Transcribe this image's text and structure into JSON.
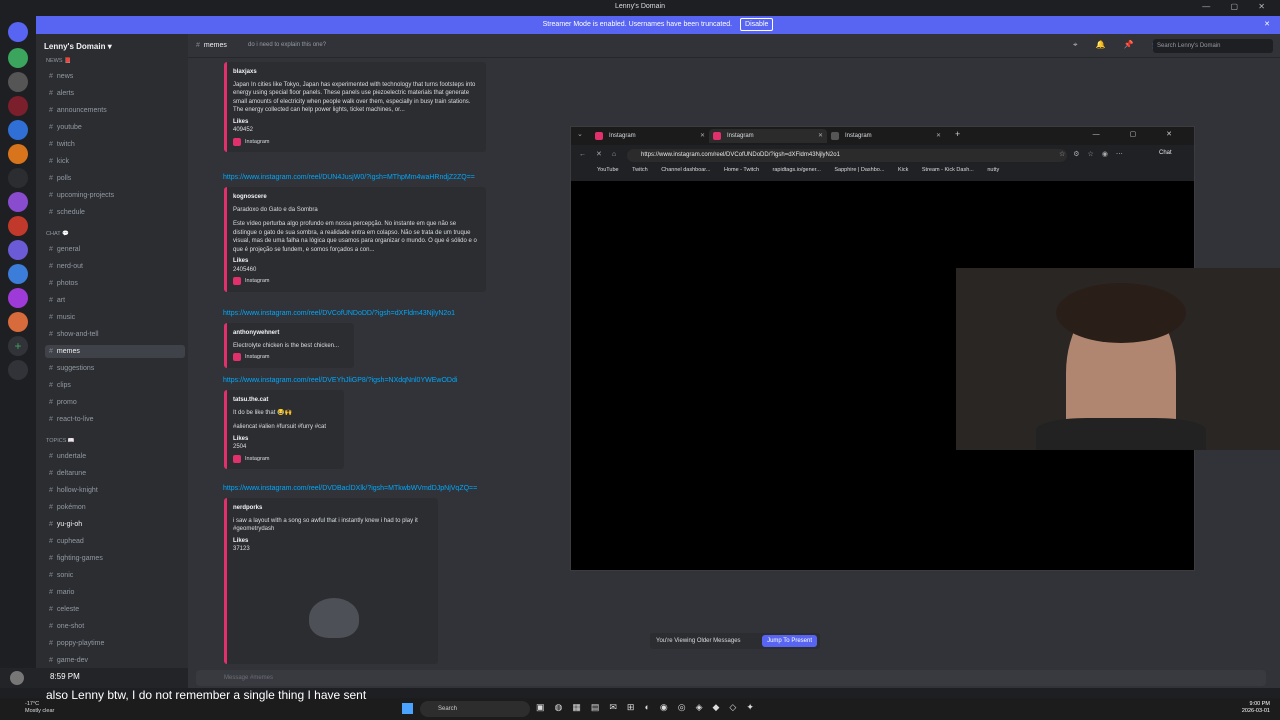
{
  "window": {
    "title": "Lenny's Domain"
  },
  "banner": {
    "text": "Streamer Mode is enabled. Usernames have been truncated.",
    "disable_label": "Disable"
  },
  "server": {
    "name": "Lenny's Domain ▾"
  },
  "sidebar": {
    "categories": [
      {
        "label": "NEWS 📕"
      },
      {
        "label": "CHAT 💬"
      },
      {
        "label": "TOPICS 📖"
      }
    ],
    "channels": [
      {
        "label": "news"
      },
      {
        "label": "alerts"
      },
      {
        "label": "announcements"
      },
      {
        "label": "youtube"
      },
      {
        "label": "twitch"
      },
      {
        "label": "kick"
      },
      {
        "label": "polls"
      },
      {
        "label": "upcoming-projects"
      },
      {
        "label": "schedule"
      },
      {
        "label": "general"
      },
      {
        "label": "nerd-out"
      },
      {
        "label": "photos"
      },
      {
        "label": "art"
      },
      {
        "label": "music"
      },
      {
        "label": "show-and-tell"
      },
      {
        "label": "memes"
      },
      {
        "label": "suggestions"
      },
      {
        "label": "clips"
      },
      {
        "label": "promo"
      },
      {
        "label": "react-to-live"
      },
      {
        "label": "undertale"
      },
      {
        "label": "deltarune"
      },
      {
        "label": "hollow-knight"
      },
      {
        "label": "pokémon"
      },
      {
        "label": "yu-gi-oh"
      },
      {
        "label": "cuphead"
      },
      {
        "label": "fighting-games"
      },
      {
        "label": "sonic"
      },
      {
        "label": "mario"
      },
      {
        "label": "celeste"
      },
      {
        "label": "one-shot"
      },
      {
        "label": "poppy-playtime"
      },
      {
        "label": "game-dev"
      }
    ]
  },
  "header": {
    "channel": "memes",
    "topic": "do i need to explain this one?",
    "search_placeholder": "Search Lenny's Domain"
  },
  "messages": [
    {
      "author": "blaxjaxs",
      "text": "Japan In cities like Tokyo, Japan has experimented with technology that turns footsteps into energy using special floor panels. These panels use piezoelectric materials that generate small amounts of electricity when people walk over them, especially in busy train stations. The energy collected can help power lights, ticket machines, or...",
      "likes_label": "Likes",
      "likes": "409452",
      "footer": "Instagram"
    },
    {
      "link": "https://www.instagram.com/reel/DUN4JusjW0/?igsh=MThpMm4waHRndjZ2ZQ=="
    },
    {
      "author": "kognoscere",
      "title": "Paradoxo do Gato e da Sombra",
      "text": "Este vídeo perturba algo profundo em nossa percepção. No instante em que não se distingue o gato de sua sombra, a realidade entra em colapso. Não se trata de um truque visual, mas de uma falha na lógica que usamos para organizar o mundo. O que é sólido e o que é projeção se fundem, e somos forçados a con...",
      "likes_label": "Likes",
      "likes": "2405460",
      "footer": "Instagram"
    },
    {
      "link": "https://www.instagram.com/reel/DVCofUNDoDD/?igsh=dXFldm43NjlyN2o1"
    },
    {
      "author": "anthonywehnert",
      "text": "Electrolyte chicken is the best chicken...",
      "footer": "Instagram"
    },
    {
      "link": "https://www.instagram.com/reel/DVEYhJliGP8/?igsh=NXdqNnl0YWEwODdi"
    },
    {
      "author": "tatsu.the.cat",
      "text": "It do be like that 😂🙌",
      "tags": "#aliencat #alien #fursuit #furry #cat",
      "likes_label": "Likes",
      "likes": "2504",
      "footer": "Instagram"
    },
    {
      "link": "https://www.instagram.com/reel/DVDBaclDXlk/?igsh=MTkwbWVmdDJpNjVqZQ=="
    },
    {
      "author": "nerdporks",
      "text": "i saw a layout with a song so awful that i instantly knew i had to play it #geometrydash",
      "likes_label": "Likes",
      "likes": "37123"
    }
  ],
  "browser": {
    "tabs": [
      {
        "label": "Instagram"
      },
      {
        "label": "Instagram"
      },
      {
        "label": "Instagram"
      }
    ],
    "url": "https://www.instagram.com/reel/DVCofUNDoDD/?igsh=dXFldm43NjlyN2o1",
    "chat_label": "Chat",
    "bookmarks": [
      "YouTube",
      "Twitch",
      "Channel dashboar...",
      "Home - Twitch",
      "rapidtags.io/gener...",
      "Sapphire | Dashbo...",
      "Kick",
      "Stream - Kick Dash...",
      "nutty"
    ]
  },
  "older_messages": {
    "text": "You're Viewing Older Messages",
    "jump_label": "Jump To Present"
  },
  "composer": {
    "placeholder": "Message #memes"
  },
  "caption": {
    "text": "also Lenny btw, I do not remember a single thing I have sent"
  },
  "overlay_time": "8:59 PM",
  "taskbar": {
    "weather_temp": "-17°C",
    "weather_desc": "Mostly clear",
    "search_label": "Search",
    "time": "9:00 PM",
    "date": "2026-03-01"
  }
}
